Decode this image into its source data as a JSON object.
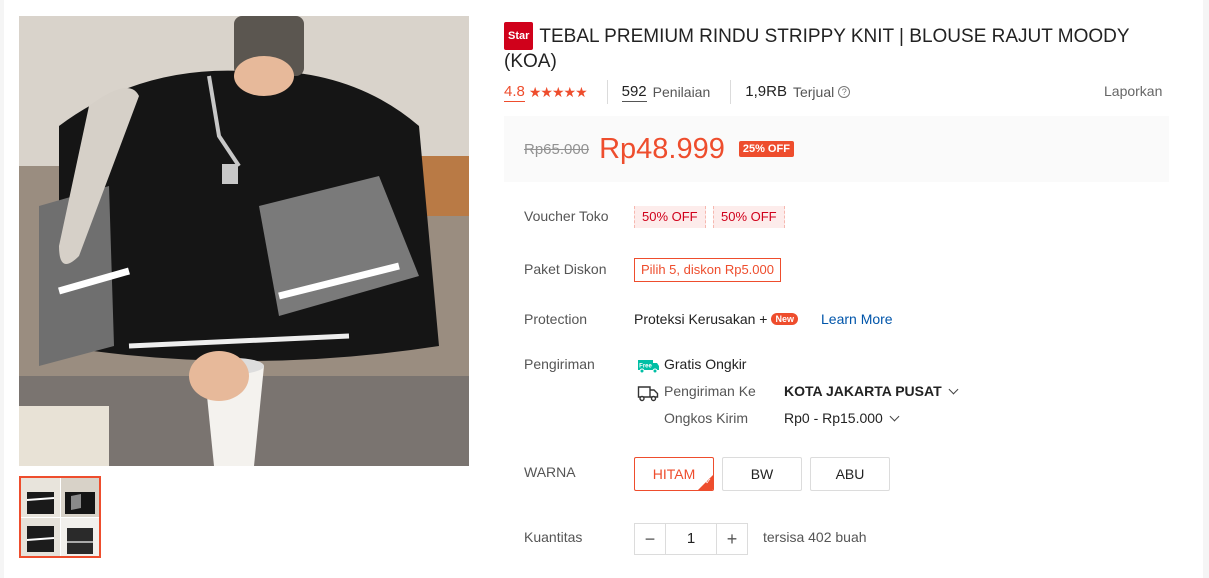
{
  "product": {
    "badge": "Star",
    "title": "TEBAL PREMIUM RINDU STRIPPY KNIT | BLOUSE RAJUT MOODY (KOA)"
  },
  "stats": {
    "rating": "4.8",
    "stars": "★★★★★",
    "reviews_count": "592",
    "reviews_label": "Penilaian",
    "sold_count": "1,9RB",
    "sold_label": "Terjual",
    "report_label": "Laporkan"
  },
  "price": {
    "original": "Rp65.000",
    "current": "Rp48.999",
    "discount": "25% OFF"
  },
  "voucher": {
    "label": "Voucher Toko",
    "items": [
      "50% OFF",
      "50% OFF"
    ]
  },
  "paket": {
    "label": "Paket Diskon",
    "value": "Pilih 5, diskon Rp5.000"
  },
  "protection": {
    "label": "Protection",
    "value": "Proteksi Kerusakan +",
    "badge": "New",
    "link": "Learn More"
  },
  "shipping": {
    "label": "Pengiriman",
    "free_badge": "Free",
    "free_text": "Gratis Ongkir",
    "to_label": "Pengiriman Ke",
    "to_value": "KOTA JAKARTA PUSAT",
    "cost_label": "Ongkos Kirim",
    "cost_value": "Rp0 - Rp15.000"
  },
  "variants": {
    "label": "WARNA",
    "options": [
      "HITAM",
      "BW",
      "ABU"
    ],
    "selected": "HITAM"
  },
  "quantity": {
    "label": "Kuantitas",
    "minus": "−",
    "value": "1",
    "plus": "+",
    "stock": "tersisa 402 buah"
  },
  "colors": {
    "accent": "#ee4d2d",
    "link": "#0055aa",
    "free_shipping": "#00bfa5"
  }
}
